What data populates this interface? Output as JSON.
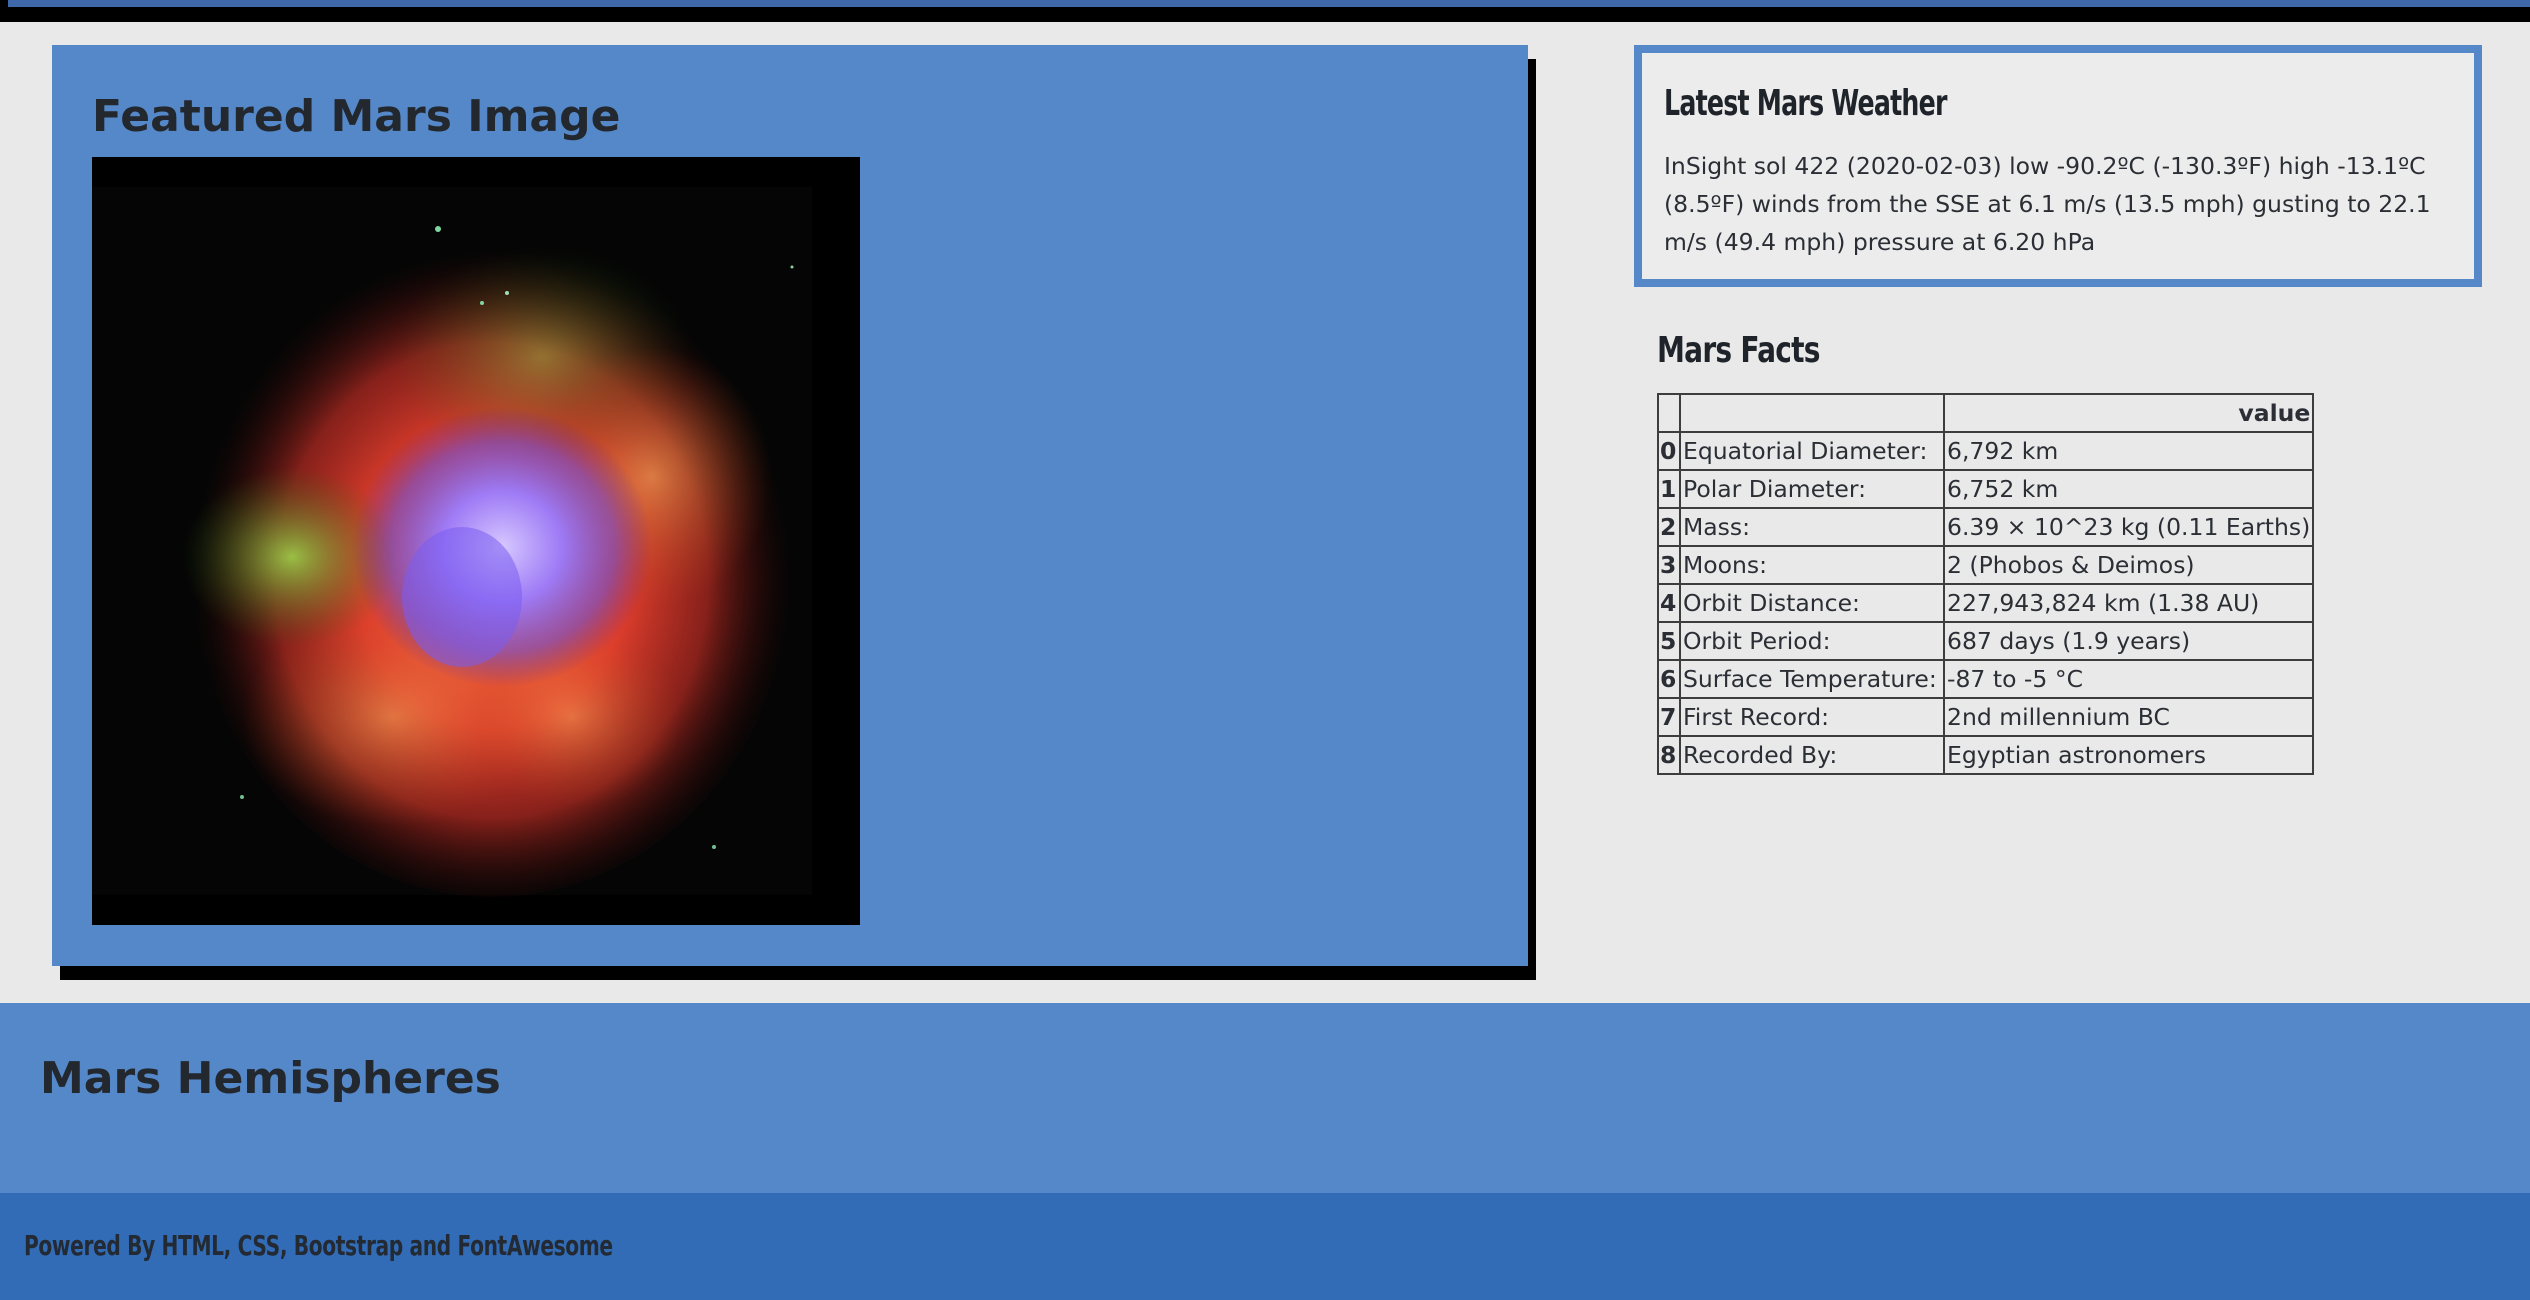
{
  "featured": {
    "title": "Featured Mars Image",
    "image_name": "crab-nebula"
  },
  "weather": {
    "title": "Latest Mars Weather",
    "text": "InSight sol 422 (2020-02-03) low -90.2ºC (-130.3ºF) high -13.1ºC (8.5ºF) winds from the SSE at 6.1 m/s (13.5 mph) gusting to 22.1 m/s (49.4 mph) pressure at 6.20 hPa"
  },
  "facts": {
    "title": "Mars Facts",
    "header": {
      "index": "",
      "label": "",
      "value": "value"
    },
    "rows": [
      {
        "index": "0",
        "label": "Equatorial Diameter:",
        "value": "6,792 km"
      },
      {
        "index": "1",
        "label": "Polar Diameter:",
        "value": "6,752 km"
      },
      {
        "index": "2",
        "label": "Mass:",
        "value": "6.39 × 10^23 kg (0.11 Earths)"
      },
      {
        "index": "3",
        "label": "Moons:",
        "value": "2 (Phobos & Deimos)"
      },
      {
        "index": "4",
        "label": "Orbit Distance:",
        "value": "227,943,824 km (1.38 AU)"
      },
      {
        "index": "5",
        "label": "Orbit Period:",
        "value": "687 days (1.9 years)"
      },
      {
        "index": "6",
        "label": "Surface Temperature:",
        "value": "-87 to -5 °C"
      },
      {
        "index": "7",
        "label": "First Record:",
        "value": "2nd millennium BC"
      },
      {
        "index": "8",
        "label": "Recorded By:",
        "value": "Egyptian astronomers"
      }
    ]
  },
  "hemispheres": {
    "title": "Mars Hemispheres"
  },
  "footer": {
    "text": "Powered By HTML, CSS, Bootstrap and FontAwesome"
  },
  "colors": {
    "page_background": "#e9e9e9",
    "card_blue": "#5588c9",
    "footer_blue": "#326cb6",
    "shadow": "#000000"
  }
}
